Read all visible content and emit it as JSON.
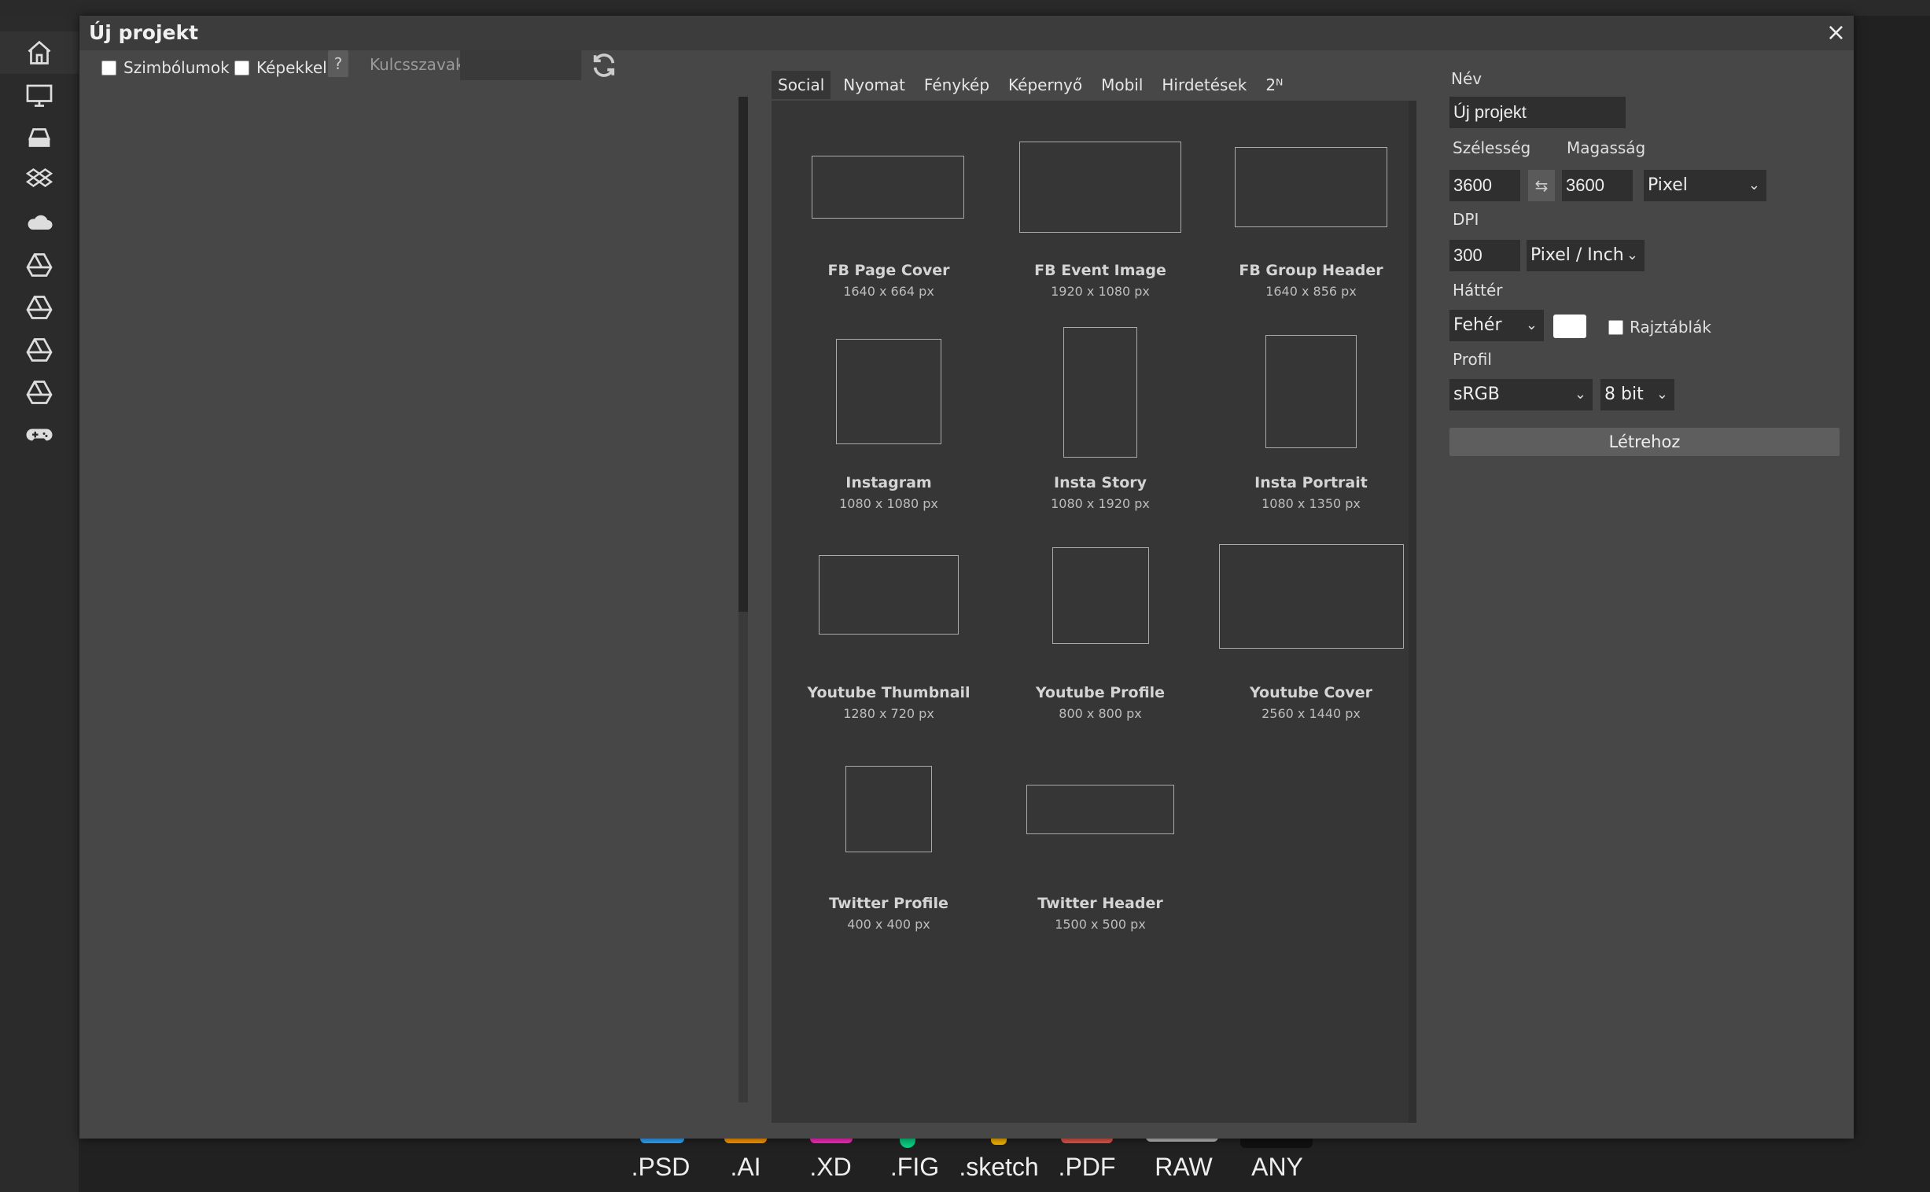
{
  "dialog": {
    "title": "Új projekt",
    "close_label": "×"
  },
  "search": {
    "symbols_label": "Szimbólumok",
    "with_images_label": "Képekkel",
    "help_label": "?",
    "keywords_label": "Kulcsszavak:",
    "keywords_value": ""
  },
  "tabs": [
    {
      "label": "Social"
    },
    {
      "label": "Nyomat"
    },
    {
      "label": "Fénykép"
    },
    {
      "label": "Képernyő"
    },
    {
      "label": "Mobil"
    },
    {
      "label": "Hirdetések"
    },
    {
      "label": "2ᴺ"
    }
  ],
  "presets": [
    {
      "name": "FB Page Cover",
      "size": "1640 x 664 px"
    },
    {
      "name": "FB Event Image",
      "size": "1920 x 1080 px"
    },
    {
      "name": "FB Group Header",
      "size": "1640 x 856 px"
    },
    {
      "name": "Instagram",
      "size": "1080 x 1080 px"
    },
    {
      "name": "Insta Story",
      "size": "1080 x 1920 px"
    },
    {
      "name": "Insta Portrait",
      "size": "1080 x 1350 px"
    },
    {
      "name": "Youtube Thumbnail",
      "size": "1280 x 720 px"
    },
    {
      "name": "Youtube Profile",
      "size": "800 x 800 px"
    },
    {
      "name": "Youtube Cover",
      "size": "2560 x 1440 px"
    },
    {
      "name": "Twitter Profile",
      "size": "400 x 400 px"
    },
    {
      "name": "Twitter Header",
      "size": "1500 x 500 px"
    }
  ],
  "form": {
    "name_label": "Név",
    "name_value": "Új projekt",
    "width_label": "Szélesség",
    "height_label": "Magasság",
    "width_value": "3600",
    "height_value": "3600",
    "swap_label": "⇆",
    "unit_value": "Pixel",
    "dpi_label": "DPI",
    "dpi_value": "300",
    "dpi_unit_value": "Pixel / Inch",
    "background_label": "Háttér",
    "background_value": "Fehér",
    "background_color": "#ffffff",
    "artboards_label": "Rajztáblák",
    "profile_label": "Profil",
    "profile_value": "sRGB",
    "bit_depth_value": "8 bit",
    "create_label": "Létrehoz"
  },
  "formats": [
    {
      "label": ".PSD",
      "color": "#31a8ff"
    },
    {
      "label": ".AI",
      "color": "#ff9a00"
    },
    {
      "label": ".XD",
      "color": "#ff2bc2"
    },
    {
      "label": ".FIG",
      "color": "#0acf83"
    },
    {
      "label": ".sketch",
      "color": "#f7b500"
    },
    {
      "label": ".PDF",
      "color": "#e2574c"
    },
    {
      "label": "RAW",
      "color": "#bbbbbb"
    },
    {
      "label": "ANY",
      "color": "#111111"
    }
  ],
  "sidebar": {
    "icons": [
      "home-icon",
      "monitor-icon",
      "drive-icon",
      "dropbox-icon",
      "onedrive-icon",
      "google-drive-icon",
      "google-drive-icon",
      "google-drive-icon",
      "google-drive-icon",
      "gamepad-icon"
    ]
  }
}
